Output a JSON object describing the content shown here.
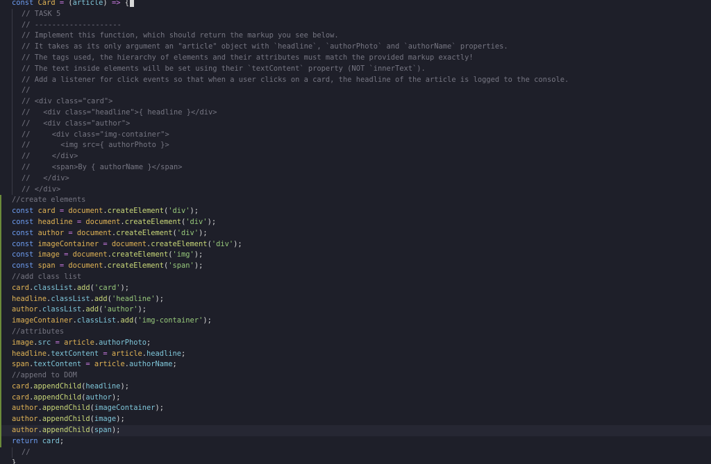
{
  "editor": {
    "lines": [
      {
        "indent": false,
        "mod": false,
        "current": false,
        "tokens": [
          {
            "c": "kw",
            "t": "const "
          },
          {
            "c": "id",
            "t": "Card"
          },
          {
            "c": "op",
            "t": " = "
          },
          {
            "c": "pl",
            "t": "("
          },
          {
            "c": "pr",
            "t": "article"
          },
          {
            "c": "pl",
            "t": ") "
          },
          {
            "c": "op",
            "t": "=>"
          },
          {
            "c": "pl",
            "t": " {"
          }
        ]
      },
      {
        "indent": true,
        "mod": false,
        "current": false,
        "tokens": [
          {
            "c": "cm",
            "t": "// TASK 5"
          }
        ]
      },
      {
        "indent": true,
        "mod": false,
        "current": false,
        "tokens": [
          {
            "c": "cm",
            "t": "// --------------------"
          }
        ]
      },
      {
        "indent": true,
        "mod": false,
        "current": false,
        "tokens": [
          {
            "c": "cm",
            "t": "// Implement this function, which should return the markup you see below."
          }
        ]
      },
      {
        "indent": true,
        "mod": false,
        "current": false,
        "tokens": [
          {
            "c": "cm",
            "t": "// It takes as its only argument an \"article\" object with `headline`, `authorPhoto` and `authorName` properties."
          }
        ]
      },
      {
        "indent": true,
        "mod": false,
        "current": false,
        "tokens": [
          {
            "c": "cm",
            "t": "// The tags used, the hierarchy of elements and their attributes must match the provided markup exactly!"
          }
        ]
      },
      {
        "indent": true,
        "mod": false,
        "current": false,
        "tokens": [
          {
            "c": "cm",
            "t": "// The text inside elements will be set using their `textContent` property (NOT `innerText`)."
          }
        ]
      },
      {
        "indent": true,
        "mod": false,
        "current": false,
        "tokens": [
          {
            "c": "cm",
            "t": "// Add a listener for click events so that when a user clicks on a card, the headline of the article is logged to the console."
          }
        ]
      },
      {
        "indent": true,
        "mod": false,
        "current": false,
        "tokens": [
          {
            "c": "cm",
            "t": "//"
          }
        ]
      },
      {
        "indent": true,
        "mod": false,
        "current": false,
        "tokens": [
          {
            "c": "cm",
            "t": "// <div class=\"card\">"
          }
        ]
      },
      {
        "indent": true,
        "mod": false,
        "current": false,
        "tokens": [
          {
            "c": "cm",
            "t": "//   <div class=\"headline\">{ headline }</div>"
          }
        ]
      },
      {
        "indent": true,
        "mod": false,
        "current": false,
        "tokens": [
          {
            "c": "cm",
            "t": "//   <div class=\"author\">"
          }
        ]
      },
      {
        "indent": true,
        "mod": false,
        "current": false,
        "tokens": [
          {
            "c": "cm",
            "t": "//     <div class=\"img-container\">"
          }
        ]
      },
      {
        "indent": true,
        "mod": false,
        "current": false,
        "tokens": [
          {
            "c": "cm",
            "t": "//       <img src={ authorPhoto }>"
          }
        ]
      },
      {
        "indent": true,
        "mod": false,
        "current": false,
        "tokens": [
          {
            "c": "cm",
            "t": "//     </div>"
          }
        ]
      },
      {
        "indent": true,
        "mod": false,
        "current": false,
        "tokens": [
          {
            "c": "cm",
            "t": "//     <span>By { authorName }</span>"
          }
        ]
      },
      {
        "indent": true,
        "mod": false,
        "current": false,
        "tokens": [
          {
            "c": "cm",
            "t": "//   </div>"
          }
        ]
      },
      {
        "indent": true,
        "mod": false,
        "current": false,
        "tokens": [
          {
            "c": "cm",
            "t": "// </div>"
          }
        ]
      },
      {
        "indent": false,
        "mod": true,
        "current": false,
        "tokens": [
          {
            "c": "cm",
            "t": "//create elements"
          }
        ]
      },
      {
        "indent": false,
        "mod": true,
        "current": false,
        "tokens": [
          {
            "c": "kw",
            "t": "const "
          },
          {
            "c": "id",
            "t": "card"
          },
          {
            "c": "op",
            "t": " = "
          },
          {
            "c": "tt",
            "t": "document"
          },
          {
            "c": "pl",
            "t": "."
          },
          {
            "c": "mt",
            "t": "createElement"
          },
          {
            "c": "pl",
            "t": "("
          },
          {
            "c": "st",
            "t": "'div'"
          },
          {
            "c": "pl",
            "t": ");"
          }
        ]
      },
      {
        "indent": false,
        "mod": true,
        "current": false,
        "tokens": [
          {
            "c": "kw",
            "t": "const "
          },
          {
            "c": "id",
            "t": "headline"
          },
          {
            "c": "op",
            "t": " = "
          },
          {
            "c": "tt",
            "t": "document"
          },
          {
            "c": "pl",
            "t": "."
          },
          {
            "c": "mt",
            "t": "createElement"
          },
          {
            "c": "pl",
            "t": "("
          },
          {
            "c": "st",
            "t": "'div'"
          },
          {
            "c": "pl",
            "t": ");"
          }
        ]
      },
      {
        "indent": false,
        "mod": true,
        "current": false,
        "tokens": [
          {
            "c": "kw",
            "t": "const "
          },
          {
            "c": "id",
            "t": "author"
          },
          {
            "c": "op",
            "t": " = "
          },
          {
            "c": "tt",
            "t": "document"
          },
          {
            "c": "pl",
            "t": "."
          },
          {
            "c": "mt",
            "t": "createElement"
          },
          {
            "c": "pl",
            "t": "("
          },
          {
            "c": "st",
            "t": "'div'"
          },
          {
            "c": "pl",
            "t": ");"
          }
        ]
      },
      {
        "indent": false,
        "mod": true,
        "current": false,
        "tokens": [
          {
            "c": "kw",
            "t": "const "
          },
          {
            "c": "id",
            "t": "imageContainer"
          },
          {
            "c": "op",
            "t": " = "
          },
          {
            "c": "tt",
            "t": "document"
          },
          {
            "c": "pl",
            "t": "."
          },
          {
            "c": "mt",
            "t": "createElement"
          },
          {
            "c": "pl",
            "t": "("
          },
          {
            "c": "st",
            "t": "'div'"
          },
          {
            "c": "pl",
            "t": ");"
          }
        ]
      },
      {
        "indent": false,
        "mod": true,
        "current": false,
        "tokens": [
          {
            "c": "kw",
            "t": "const "
          },
          {
            "c": "id",
            "t": "image"
          },
          {
            "c": "op",
            "t": " = "
          },
          {
            "c": "tt",
            "t": "document"
          },
          {
            "c": "pl",
            "t": "."
          },
          {
            "c": "mt",
            "t": "createElement"
          },
          {
            "c": "pl",
            "t": "("
          },
          {
            "c": "st",
            "t": "'img'"
          },
          {
            "c": "pl",
            "t": ");"
          }
        ]
      },
      {
        "indent": false,
        "mod": true,
        "current": false,
        "tokens": [
          {
            "c": "kw",
            "t": "const "
          },
          {
            "c": "id",
            "t": "span"
          },
          {
            "c": "op",
            "t": " = "
          },
          {
            "c": "tt",
            "t": "document"
          },
          {
            "c": "pl",
            "t": "."
          },
          {
            "c": "mt",
            "t": "createElement"
          },
          {
            "c": "pl",
            "t": "("
          },
          {
            "c": "st",
            "t": "'span'"
          },
          {
            "c": "pl",
            "t": ");"
          }
        ]
      },
      {
        "indent": false,
        "mod": true,
        "current": false,
        "tokens": [
          {
            "c": "cm",
            "t": "//add class list"
          }
        ]
      },
      {
        "indent": false,
        "mod": true,
        "current": false,
        "tokens": [
          {
            "c": "id",
            "t": "card"
          },
          {
            "c": "pl",
            "t": "."
          },
          {
            "c": "pr",
            "t": "classList"
          },
          {
            "c": "pl",
            "t": "."
          },
          {
            "c": "mt",
            "t": "add"
          },
          {
            "c": "pl",
            "t": "("
          },
          {
            "c": "st",
            "t": "'card'"
          },
          {
            "c": "pl",
            "t": ");"
          }
        ]
      },
      {
        "indent": false,
        "mod": true,
        "current": false,
        "tokens": [
          {
            "c": "id",
            "t": "headline"
          },
          {
            "c": "pl",
            "t": "."
          },
          {
            "c": "pr",
            "t": "classList"
          },
          {
            "c": "pl",
            "t": "."
          },
          {
            "c": "mt",
            "t": "add"
          },
          {
            "c": "pl",
            "t": "("
          },
          {
            "c": "st",
            "t": "'headline'"
          },
          {
            "c": "pl",
            "t": ");"
          }
        ]
      },
      {
        "indent": false,
        "mod": true,
        "current": false,
        "tokens": [
          {
            "c": "id",
            "t": "author"
          },
          {
            "c": "pl",
            "t": "."
          },
          {
            "c": "pr",
            "t": "classList"
          },
          {
            "c": "pl",
            "t": "."
          },
          {
            "c": "mt",
            "t": "add"
          },
          {
            "c": "pl",
            "t": "("
          },
          {
            "c": "st",
            "t": "'author'"
          },
          {
            "c": "pl",
            "t": ");"
          }
        ]
      },
      {
        "indent": false,
        "mod": true,
        "current": false,
        "tokens": [
          {
            "c": "id",
            "t": "imageContainer"
          },
          {
            "c": "pl",
            "t": "."
          },
          {
            "c": "pr",
            "t": "classList"
          },
          {
            "c": "pl",
            "t": "."
          },
          {
            "c": "mt",
            "t": "add"
          },
          {
            "c": "pl",
            "t": "("
          },
          {
            "c": "st",
            "t": "'img-container'"
          },
          {
            "c": "pl",
            "t": ");"
          }
        ]
      },
      {
        "indent": false,
        "mod": true,
        "current": false,
        "tokens": [
          {
            "c": "cm",
            "t": "//attributes"
          }
        ]
      },
      {
        "indent": false,
        "mod": true,
        "current": false,
        "tokens": [
          {
            "c": "id",
            "t": "image"
          },
          {
            "c": "pl",
            "t": "."
          },
          {
            "c": "pr",
            "t": "src"
          },
          {
            "c": "op",
            "t": " = "
          },
          {
            "c": "tt",
            "t": "article"
          },
          {
            "c": "pl",
            "t": "."
          },
          {
            "c": "pr",
            "t": "authorPhoto"
          },
          {
            "c": "pl",
            "t": ";"
          }
        ]
      },
      {
        "indent": false,
        "mod": true,
        "current": false,
        "tokens": [
          {
            "c": "id",
            "t": "headline"
          },
          {
            "c": "pl",
            "t": "."
          },
          {
            "c": "pr",
            "t": "textContent"
          },
          {
            "c": "op",
            "t": " = "
          },
          {
            "c": "tt",
            "t": "article"
          },
          {
            "c": "pl",
            "t": "."
          },
          {
            "c": "pr",
            "t": "headline"
          },
          {
            "c": "pl",
            "t": ";"
          }
        ]
      },
      {
        "indent": false,
        "mod": true,
        "current": false,
        "tokens": [
          {
            "c": "id",
            "t": "span"
          },
          {
            "c": "pl",
            "t": "."
          },
          {
            "c": "pr",
            "t": "textContent"
          },
          {
            "c": "op",
            "t": " = "
          },
          {
            "c": "tt",
            "t": "article"
          },
          {
            "c": "pl",
            "t": "."
          },
          {
            "c": "pr",
            "t": "authorName"
          },
          {
            "c": "pl",
            "t": ";"
          }
        ]
      },
      {
        "indent": false,
        "mod": true,
        "current": false,
        "tokens": [
          {
            "c": "cm",
            "t": "//append to DOM"
          }
        ]
      },
      {
        "indent": false,
        "mod": true,
        "current": false,
        "tokens": [
          {
            "c": "id",
            "t": "card"
          },
          {
            "c": "pl",
            "t": "."
          },
          {
            "c": "mt",
            "t": "appendChild"
          },
          {
            "c": "pl",
            "t": "("
          },
          {
            "c": "pr",
            "t": "headline"
          },
          {
            "c": "pl",
            "t": ");"
          }
        ]
      },
      {
        "indent": false,
        "mod": true,
        "current": false,
        "tokens": [
          {
            "c": "id",
            "t": "card"
          },
          {
            "c": "pl",
            "t": "."
          },
          {
            "c": "mt",
            "t": "appendChild"
          },
          {
            "c": "pl",
            "t": "("
          },
          {
            "c": "pr",
            "t": "author"
          },
          {
            "c": "pl",
            "t": ");"
          }
        ]
      },
      {
        "indent": false,
        "mod": true,
        "current": false,
        "tokens": [
          {
            "c": "id",
            "t": "author"
          },
          {
            "c": "pl",
            "t": "."
          },
          {
            "c": "mt",
            "t": "appendChild"
          },
          {
            "c": "pl",
            "t": "("
          },
          {
            "c": "pr",
            "t": "imageContainer"
          },
          {
            "c": "pl",
            "t": ");"
          }
        ]
      },
      {
        "indent": false,
        "mod": true,
        "current": false,
        "tokens": [
          {
            "c": "id",
            "t": "author"
          },
          {
            "c": "pl",
            "t": "."
          },
          {
            "c": "mt",
            "t": "appendChild"
          },
          {
            "c": "pl",
            "t": "("
          },
          {
            "c": "pr",
            "t": "image"
          },
          {
            "c": "pl",
            "t": ");"
          }
        ]
      },
      {
        "indent": false,
        "mod": true,
        "current": true,
        "tokens": [
          {
            "c": "id",
            "t": "author"
          },
          {
            "c": "pl",
            "t": "."
          },
          {
            "c": "mt",
            "t": "appendChild"
          },
          {
            "c": "pl",
            "t": "("
          },
          {
            "c": "pr",
            "t": "span"
          },
          {
            "c": "pl",
            "t": ");"
          }
        ]
      },
      {
        "indent": false,
        "mod": true,
        "current": false,
        "tokens": [
          {
            "c": "kw",
            "t": "return "
          },
          {
            "c": "pr",
            "t": "card"
          },
          {
            "c": "pl",
            "t": ";"
          }
        ]
      },
      {
        "indent": true,
        "mod": false,
        "current": false,
        "tokens": [
          {
            "c": "cm",
            "t": "//"
          }
        ]
      },
      {
        "indent": false,
        "mod": false,
        "current": false,
        "tokens": [
          {
            "c": "pl",
            "t": "}"
          }
        ]
      }
    ]
  }
}
